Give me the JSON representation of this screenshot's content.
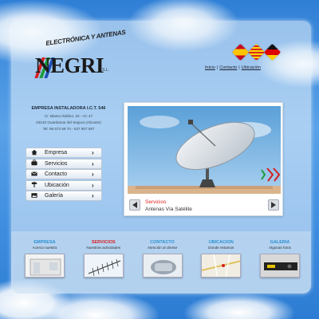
{
  "logo": {
    "arc_text": "ELECTRÓNICA Y ANTENAS",
    "name": "NEGRI",
    "suffix": "S.L."
  },
  "top_links": [
    "Inicio",
    "Contacto",
    "Ubicación"
  ],
  "company": {
    "name": "EMPRESA INSTALADORA I.C.T. 546",
    "address": "C/. Blasco Ibáñez, 33 - AC 47",
    "city": "03140 Guardamar del Segura (Alicante)",
    "phone": "Tel: 96 672 59 70 - 637 807 587"
  },
  "menu": [
    {
      "label": "Empresa",
      "icon": "house-icon"
    },
    {
      "label": "Servicios",
      "icon": "briefcase-icon"
    },
    {
      "label": "Contacto",
      "icon": "envelope-icon"
    },
    {
      "label": "Ubicación",
      "icon": "signpost-icon"
    },
    {
      "label": "Galería",
      "icon": "photo-icon"
    }
  ],
  "slider": {
    "title": "Servicios",
    "subtitle": "Antenas Vía Satélite"
  },
  "tiles": [
    {
      "title": "EMPRESA",
      "subtitle": "Acerca nuestra",
      "color": "#2a8fd0"
    },
    {
      "title": "SERVICIOS",
      "subtitle": "Nuestras actividades",
      "color": "#d62020"
    },
    {
      "title": "CONTACTO",
      "subtitle": "Atención al cliente",
      "color": "#2a8fd0"
    },
    {
      "title": "UBICACION",
      "subtitle": "Donde estamos",
      "color": "#2a8fd0"
    },
    {
      "title": "GALERIA",
      "subtitle": "Algunas fotos",
      "color": "#2a8fd0"
    }
  ],
  "colors": {
    "accent_red": "#d62020",
    "accent_blue": "#2a8fd0"
  }
}
